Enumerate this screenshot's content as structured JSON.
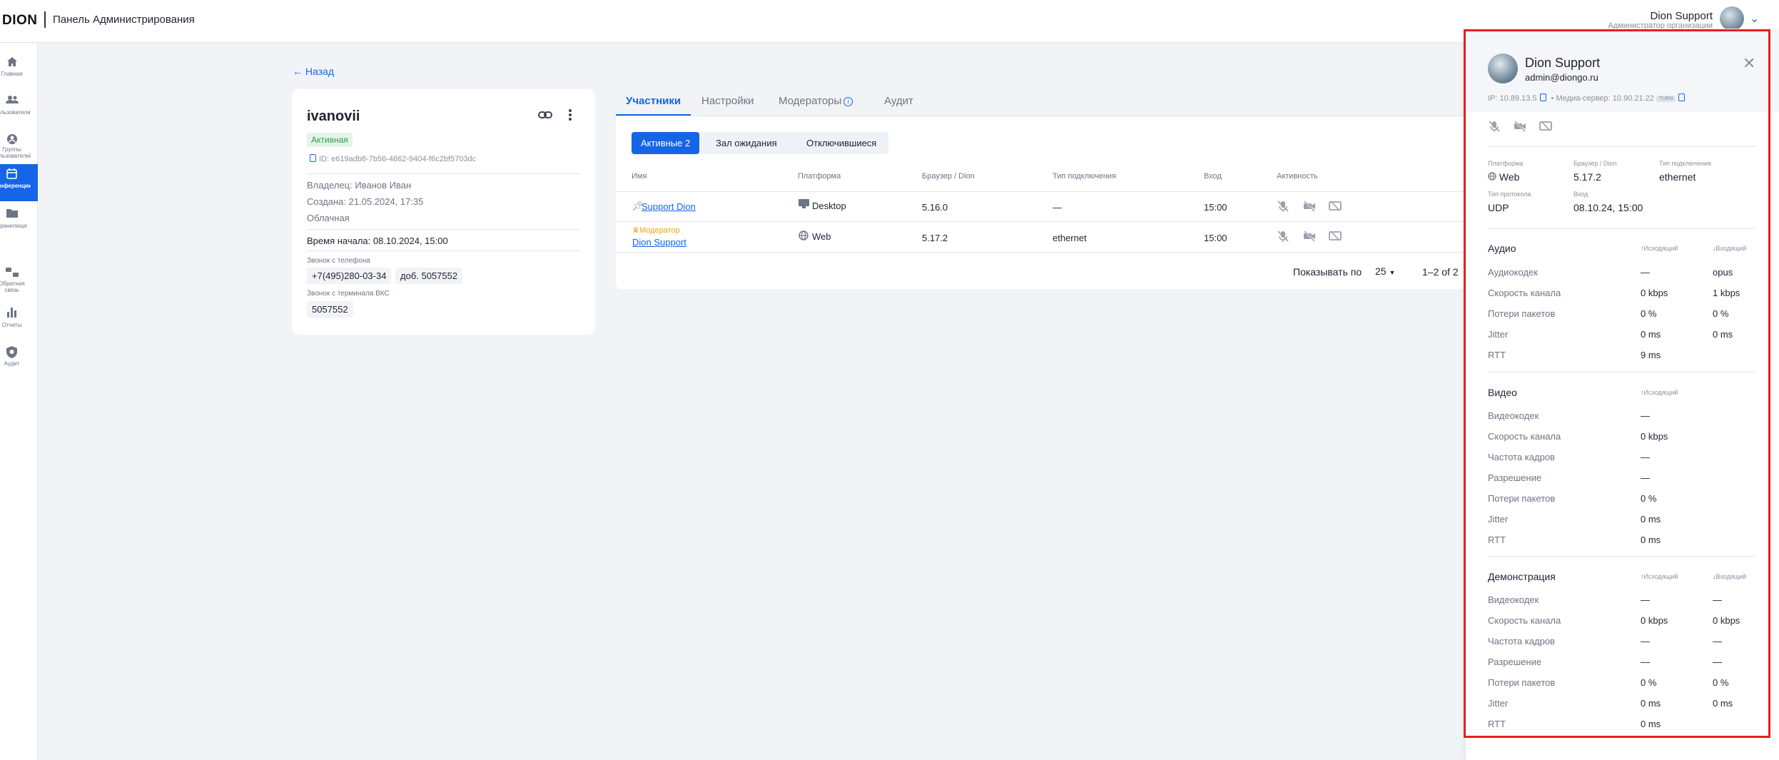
{
  "header": {
    "logo": "DION",
    "app_title": "Панель Администрирования",
    "user_name": "Dion Support",
    "user_role": "Администратор организации"
  },
  "sidebar": {
    "items": [
      {
        "label": "Главная",
        "icon": "home-icon"
      },
      {
        "label": "Пользователи",
        "icon": "users-icon"
      },
      {
        "label": "Группы пользователей",
        "icon": "groups-icon"
      },
      {
        "label": "Конференции",
        "icon": "calendar-icon",
        "active": true
      },
      {
        "label": "Хранилище",
        "icon": "folder-icon"
      },
      {
        "label": "Обратная связь",
        "icon": "feedback-icon"
      },
      {
        "label": "Отчеты",
        "icon": "chart-icon"
      },
      {
        "label": "Аудит",
        "icon": "shield-icon"
      }
    ]
  },
  "back": "Назад",
  "conference": {
    "name": "ivanovii",
    "status": "Активная",
    "id": "ID: e619adb8-7b56-4862-9404-f6c2bf5703dc",
    "owner": "Владелец: Иванов Иван",
    "created": "Создана: 21.05.2024, 17:35",
    "type": "Облачная",
    "start": "Время начала: 08.10.2024, 15:00",
    "phone_label": "Звонок с телефона",
    "phone": "+7(495)280-03-34",
    "ext": "доб. 5057552",
    "vks_label": "Звонок с терминала ВКС",
    "vks": "5057552"
  },
  "tabs": [
    "Участники",
    "Настройки",
    "Модераторы",
    "Аудит"
  ],
  "segments": [
    "Активные 2",
    "Зал ожидания",
    "Отключившиеся"
  ],
  "table": {
    "headers": [
      "Имя",
      "Платформа",
      "Браузер / Dion",
      "Тип подключения",
      "Вход",
      "Активность"
    ],
    "rows": [
      {
        "name": "Support Dion",
        "platform": "Desktop",
        "browser": "5.16.0",
        "conn": "—",
        "enter": "15:00"
      },
      {
        "moderator": "Модератор",
        "name": "Dion Support",
        "platform": "Web",
        "browser": "5.17.2",
        "conn": "ethernet",
        "enter": "15:00"
      }
    ]
  },
  "pager": {
    "label": "Показывать по",
    "per_page": "25",
    "range": "1–2 of 2"
  },
  "panel": {
    "name": "Dion Support",
    "email": "admin@diongo.ru",
    "ip": "IP: 10.89.13.5",
    "media": "Медиа-сервер: 10.90.21.22",
    "turn": "TURN",
    "info": [
      {
        "label": "Платформа",
        "value": "Web"
      },
      {
        "label": "Браузер / Dion",
        "value": "5.17.2"
      },
      {
        "label": "Тип подключения",
        "value": "ethernet"
      },
      {
        "label": "Тип протокола",
        "value": "UDP"
      },
      {
        "label": "Вход",
        "value": "08.10.24, 15:00"
      }
    ],
    "out_label": "Исходящий",
    "in_label": "Входящий",
    "audio": {
      "title": "Аудио",
      "rows": [
        [
          "Аудиокодек",
          "—",
          "opus"
        ],
        [
          "Скорость канала",
          "0 kbps",
          "1 kbps"
        ],
        [
          "Потери пакетов",
          "0 %",
          "0 %"
        ],
        [
          "Jitter",
          "0 ms",
          "0 ms"
        ],
        [
          "RTT",
          "9 ms",
          ""
        ]
      ]
    },
    "video": {
      "title": "Видео",
      "rows": [
        [
          "Видеокодек",
          "—"
        ],
        [
          "Скорость канала",
          "0 kbps"
        ],
        [
          "Частота кадров",
          "—"
        ],
        [
          "Разрешение",
          "—"
        ],
        [
          "Потери пакетов",
          "0 %"
        ],
        [
          "Jitter",
          "0 ms"
        ],
        [
          "RTT",
          "0 ms"
        ]
      ]
    },
    "demo": {
      "title": "Демонстрация",
      "rows": [
        [
          "Видеокодек",
          "—",
          "—"
        ],
        [
          "Скорость канала",
          "0 kbps",
          "0 kbps"
        ],
        [
          "Частота кадров",
          "—",
          "—"
        ],
        [
          "Разрешение",
          "—",
          "—"
        ],
        [
          "Потери пакетов",
          "0 %",
          "0 %"
        ],
        [
          "Jitter",
          "0 ms",
          "0 ms"
        ],
        [
          "RTT",
          "0 ms",
          ""
        ]
      ]
    }
  }
}
